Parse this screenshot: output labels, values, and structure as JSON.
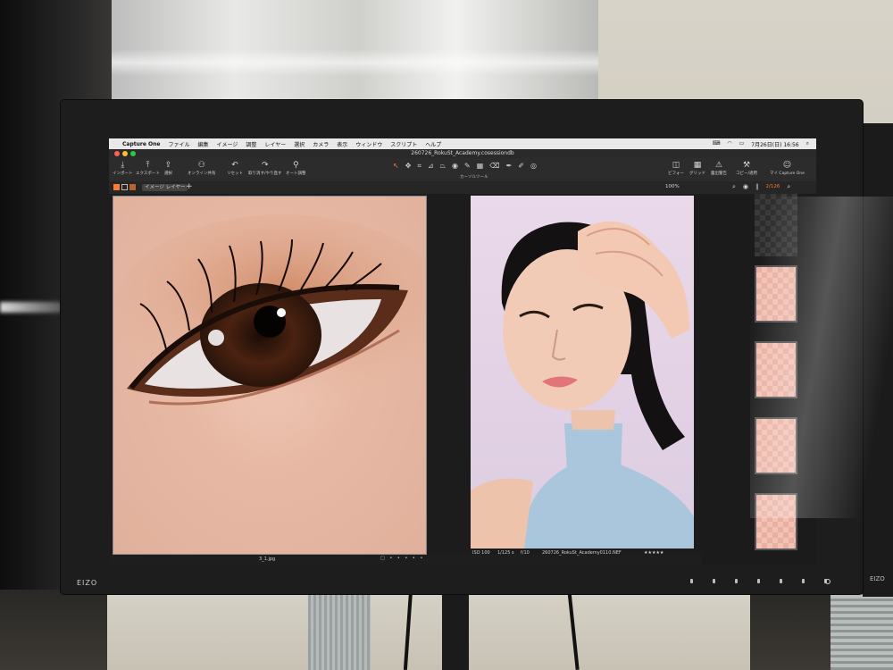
{
  "monitor": {
    "brand": "EIZO",
    "second_brand": "EIZO"
  },
  "menubar": {
    "app": "Capture One",
    "items": [
      "ファイル",
      "編集",
      "イメージ",
      "調整",
      "レイヤー",
      "選択",
      "カメラ",
      "表示",
      "ウィンドウ",
      "スクリプト",
      "ヘルプ"
    ],
    "clock": "7月26日(日) 16:56",
    "status_icons": [
      "keyboard-icon",
      "wifi-icon",
      "battery-icon",
      "search-icon"
    ]
  },
  "window": {
    "title": "260726_RokuSt_Academy.cosessiondb"
  },
  "toolbar": {
    "left_tools": [
      {
        "icon": "import-icon",
        "label": "インポート"
      },
      {
        "icon": "export-icon",
        "label": "エクスポート"
      },
      {
        "icon": "share-icon",
        "label": "選択"
      },
      {
        "icon": "people-icon",
        "label": "オンライン共有"
      },
      {
        "icon": "undo-icon",
        "label": "リセット"
      },
      {
        "icon": "redo-icon",
        "label": "取り消す/やり直す"
      },
      {
        "icon": "wand-icon",
        "label": "オート調整"
      }
    ],
    "cursor_tools_label": "カーソルツール",
    "right_tools": [
      {
        "icon": "viewer-icon",
        "label": "ビフォー"
      },
      {
        "icon": "grid-icon",
        "label": "グリッド"
      },
      {
        "icon": "warning-icon",
        "label": "露出警告"
      },
      {
        "icon": "copy-icon",
        "label": "コピー/適用"
      },
      {
        "icon": "user-icon",
        "label": "マイ Capture One"
      }
    ]
  },
  "subbar": {
    "tab_label": "イメージ レイヤー",
    "zoom": "100%",
    "counter": "2/126"
  },
  "viewer": {
    "left": {
      "filename": "3_1.jpg"
    },
    "right": {
      "iso": "ISO 100",
      "shutter": "1/125 s",
      "aperture": "f/10",
      "filename": "260726_RokuSt_Academy0110.NEF",
      "rating": "★★★★★"
    }
  },
  "colors": {
    "accent": "#ff7a2e",
    "toolbar_bg": "#2c2c2c",
    "menubar_bg": "#e9e9e9",
    "viewer_bg": "#1c1c1c",
    "backdrop_pink": "#e6d6e8",
    "top_blue": "#a9c6dd"
  }
}
